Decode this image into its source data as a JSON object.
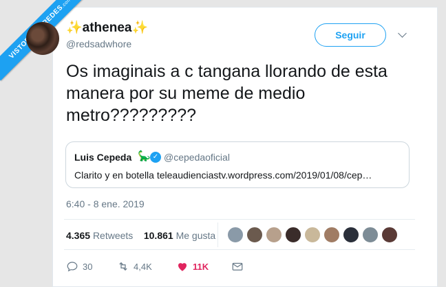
{
  "watermark": {
    "text": "VISTOENLASREDES",
    "suffix": ".com"
  },
  "user": {
    "display_name": "✨athenea✨",
    "handle": "@redsadwhore"
  },
  "follow_label": "Seguir",
  "tweet_text": "Os imaginais a c tangana llorando de esta manera por su meme de medio metro?????????",
  "quote": {
    "name": "Luis Cepeda",
    "emoji": "🦕",
    "handle": "@cepedaoficial",
    "text": "Clarito y en botella teleaudienciastv.wordpress.com/2019/01/08/cep…"
  },
  "timestamp": "6:40 - 8 ene. 2019",
  "stats": {
    "retweets_value": "4.365",
    "retweets_label": "Retweets",
    "likes_value": "10.861",
    "likes_label": "Me gusta"
  },
  "likers_colors": [
    "#8a9aa8",
    "#6b5a4e",
    "#b7a08c",
    "#3a2c2a",
    "#c9b89a",
    "#a07c64",
    "#2a2f3a",
    "#7d8c96",
    "#5a3a36"
  ],
  "actions": {
    "replies": "30",
    "retweets": "4,4K",
    "likes": "11K"
  },
  "colors": {
    "accent": "#1da1f2",
    "like": "#e0245e",
    "muted": "#657786",
    "text": "#14171a"
  }
}
